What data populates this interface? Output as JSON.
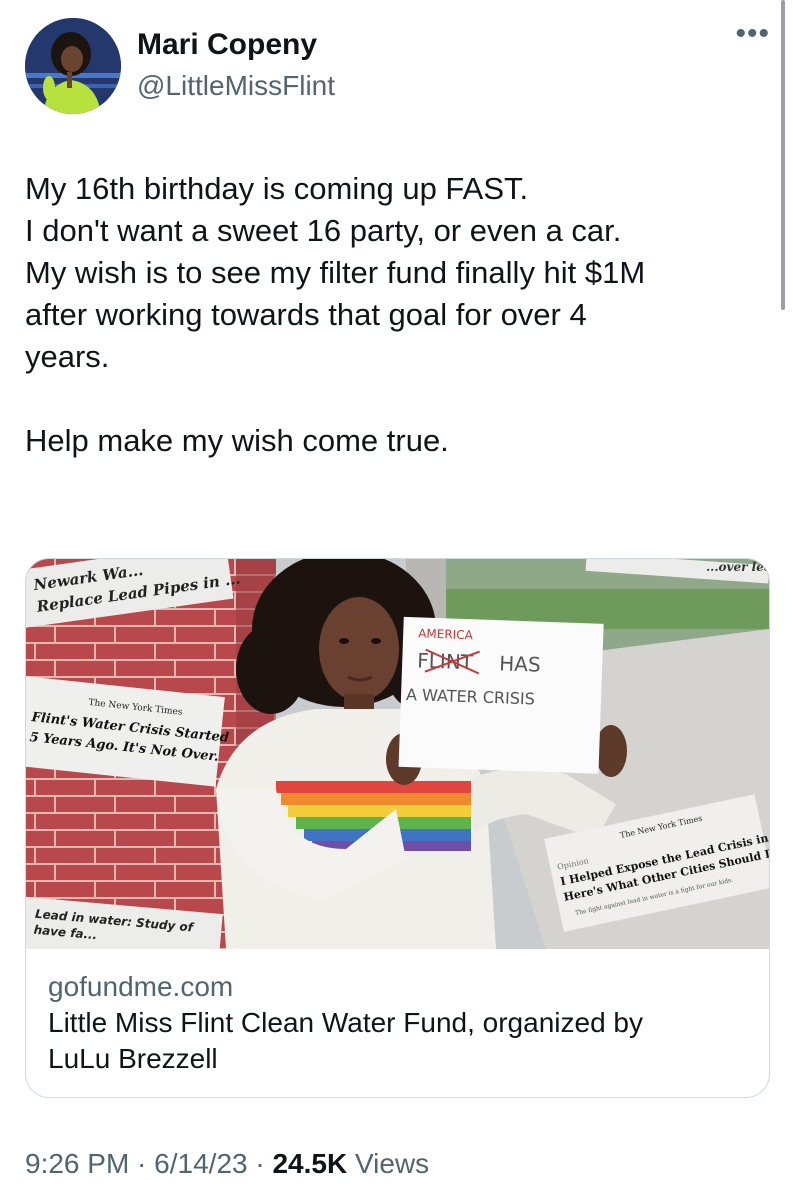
{
  "tweet": {
    "author_name": "Mari Copeny",
    "author_handle": "@LittleMissFlint",
    "more_icon": "more-horizontal-icon",
    "text_lines": [
      "My 16th birthday is coming up FAST.",
      "I don't want a sweet 16 party, or even a car.",
      "My wish is to see my filter fund finally hit $1M",
      "after working towards that goal for over 4",
      "years."
    ],
    "text_closing": "Help make my wish come true."
  },
  "card": {
    "domain": "gofundme.com",
    "title_line1": "Little Miss Flint Clean Water Fund, organized by",
    "title_line2": "LuLu Brezzell",
    "image": {
      "clip_newark_1": "Newark Wa...",
      "clip_newark_2": "Replace Lead Pipes in ...",
      "clip_topright": "...over lead",
      "clip_nyt_masthead": "The New York Times",
      "clip_nyt_headline_1": "Flint's Water Crisis Started",
      "clip_nyt_headline_2": "5 Years Ago. It's Not Over.",
      "sign_line1": "AMERICA",
      "sign_line2_struck": "FLINT",
      "sign_line2_rest": "HAS",
      "sign_line3": "A WATER CRISIS",
      "clip_op_masthead": "The New York Times",
      "clip_op_label": "Opinion",
      "clip_op_headline_1": "I Helped Expose the Lead Crisis in Flint.",
      "clip_op_headline_2": "Here's What Other Cities Should Do.",
      "clip_op_sub": "The fight against lead in water is a fight for our kids.",
      "clip_bottom_1": "Lead in water: Study of",
      "clip_bottom_2": "have fa..."
    }
  },
  "meta": {
    "time": "9:26 PM",
    "sep1": " · ",
    "date": "6/14/23",
    "sep2": " · ",
    "views_count": "24.5K",
    "views_label": " Views"
  },
  "colors": {
    "text": "#0f1419",
    "secondary": "#536471",
    "border": "#cfd9de"
  }
}
